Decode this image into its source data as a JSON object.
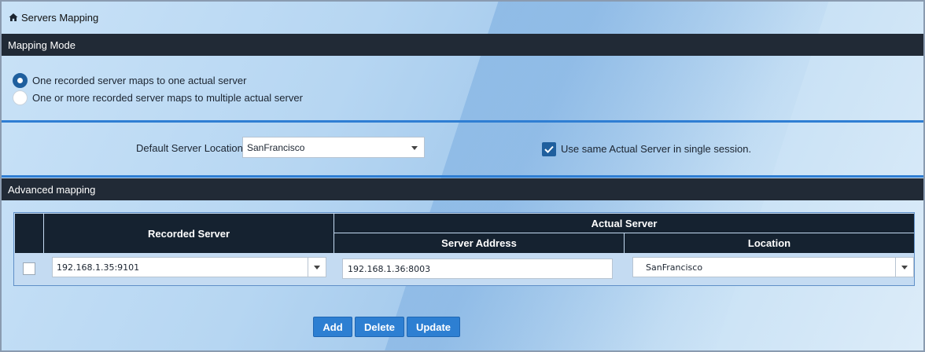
{
  "header": {
    "title": "Servers Mapping",
    "icon": "home-icon"
  },
  "mapping_mode": {
    "title": "Mapping Mode",
    "options": [
      {
        "label": "One recorded server maps to one actual server",
        "selected": true
      },
      {
        "label": "One or more recorded server maps to multiple actual server",
        "selected": false
      }
    ]
  },
  "defaults": {
    "location_label": "Default Server Location",
    "location_value": "SanFrancisco",
    "same_server_label": "Use same Actual Server in single session.",
    "same_server_checked": true
  },
  "advanced": {
    "title": "Advanced mapping",
    "columns": {
      "recorded": "Recorded Server",
      "actual": "Actual Server",
      "address": "Server Address",
      "location": "Location"
    },
    "rows": [
      {
        "checked": false,
        "recorded": "192.168.1.35:9101",
        "address": "192.168.1.36:8003",
        "location": "SanFrancisco"
      }
    ]
  },
  "buttons": {
    "add": "Add",
    "delete": "Delete",
    "update": "Update"
  },
  "colors": {
    "header_bg": "#212a36",
    "accent": "#2d7fd2",
    "divider": "#2f7ed3"
  }
}
